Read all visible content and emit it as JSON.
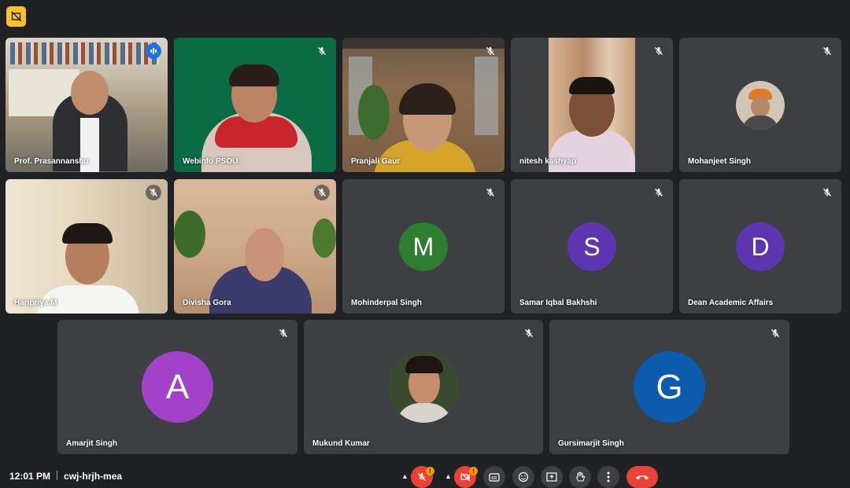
{
  "participants": [
    {
      "name": "Prof. Prasannanshu",
      "kind": "video",
      "speaking": true
    },
    {
      "name": "Webinfo PSOU",
      "kind": "video",
      "muted": true
    },
    {
      "name": "Pranjali Gaur",
      "kind": "video",
      "muted": true
    },
    {
      "name": "nitesh kashyap",
      "kind": "video",
      "muted": true
    },
    {
      "name": "Mohanjeet Singh",
      "kind": "photo-avatar",
      "muted": true
    },
    {
      "name": "Haripriya M",
      "kind": "video",
      "muted": true
    },
    {
      "name": "Divisha Gora",
      "kind": "video",
      "muted": true
    },
    {
      "name": "Mohinderpal Singh",
      "kind": "letter-avatar",
      "initial": "M",
      "color": "#2e7d32",
      "muted": true
    },
    {
      "name": "Samar Iqbal Bakhshi",
      "kind": "letter-avatar",
      "initial": "S",
      "color": "#5e35b1",
      "muted": true
    },
    {
      "name": "Dean Academic Affairs",
      "kind": "letter-avatar",
      "initial": "D",
      "color": "#5e35b1",
      "muted": true
    },
    {
      "name": "Amarjit Singh",
      "kind": "letter-avatar",
      "initial": "A",
      "color": "#a142c8",
      "muted": true
    },
    {
      "name": "Mukund Kumar",
      "kind": "photo-avatar",
      "muted": true
    },
    {
      "name": "Gursimarjit Singh",
      "kind": "letter-avatar",
      "initial": "G",
      "color": "#0b5cad",
      "muted": true
    }
  ],
  "footer": {
    "time": "12:01 PM",
    "meeting_code": "cwj-hrjh-mea"
  },
  "controls": {
    "mic_warning": "!",
    "camera_warning": "!"
  },
  "icons": {
    "top_badge": "presentation-off-icon",
    "mic": "mic-off-icon",
    "camera": "camera-off-icon",
    "captions": "captions-icon",
    "reactions": "emoji-icon",
    "present": "present-screen-icon",
    "raise_hand": "raise-hand-icon",
    "more": "more-options-icon",
    "leave": "end-call-icon"
  }
}
